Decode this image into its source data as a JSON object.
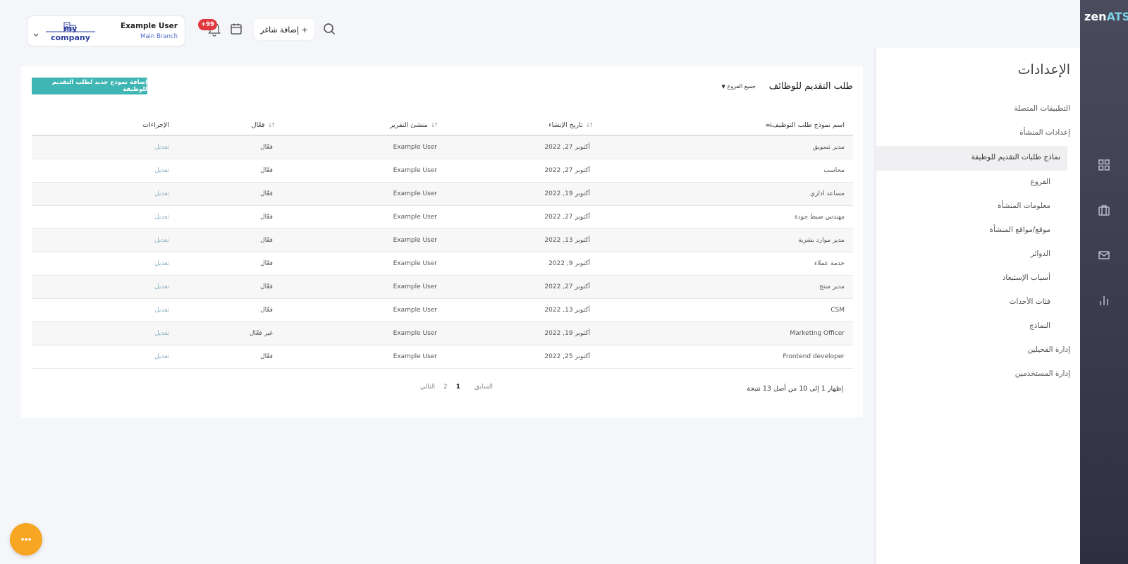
{
  "brand": {
    "logo_main": "zen",
    "logo_accent": "ATS"
  },
  "header": {
    "user_name": "Example User",
    "branch": "Main Branch",
    "company_name": "my company",
    "notification_badge": "+99",
    "add_job_label": "+ إضافة شاغر"
  },
  "settings": {
    "title": "الإعدادات",
    "items": [
      "التطبيقات المتصلة",
      "إعدادات المنشأة",
      "نماذج طلبات التقديم للوظيفة",
      "الفروع",
      "معلومات المنشأة",
      "موقع/مواقع المنشأة",
      "الدوائر",
      "أسباب الإستبعاد",
      "فئات الأحداث",
      "النماذج",
      "إدارة القحيلين",
      "إدارة المستخدمين"
    ],
    "active_index": 2
  },
  "main": {
    "title": "طلب التقديم للوظائف",
    "branch_filter": "جميع الفروع",
    "add_button": "إضافة نموذج جديد لطلب التقديم للوظيفة",
    "columns": {
      "name": "اسم نموذج طلب التوظيف",
      "date": "تاريخ الإنشاء",
      "creator": "منشئ التقرير",
      "active": "فعّال",
      "actions": "الإجراءات"
    },
    "rows": [
      {
        "name": "مدير تسويق",
        "date": "أكتوبر 27, 2022",
        "creator": "Example User",
        "active": "فعّال",
        "action": "تعديل"
      },
      {
        "name": "محاسب",
        "date": "أكتوبر 27, 2022",
        "creator": "Example User",
        "active": "فعّال",
        "action": "تعديل"
      },
      {
        "name": "مساعد اداري",
        "date": "أكتوبر 19, 2022",
        "creator": "Example User",
        "active": "فعّال",
        "action": "تعديل"
      },
      {
        "name": "مهندس ضبط جودة",
        "date": "أكتوبر 27, 2022",
        "creator": "Example User",
        "active": "فعّال",
        "action": "تعديل"
      },
      {
        "name": "مدير موارد بشرية",
        "date": "أكتوبر 13, 2022",
        "creator": "Example User",
        "active": "فعّال",
        "action": "تعديل"
      },
      {
        "name": "خدمة عملاء",
        "date": "أكتوبر 9, 2022",
        "creator": "Example User",
        "active": "فعّال",
        "action": "تعديل"
      },
      {
        "name": "مدير منتج",
        "date": "أكتوبر 27, 2022",
        "creator": "Example User",
        "active": "فعّال",
        "action": "تعديل"
      },
      {
        "name": "CSM",
        "date": "أكتوبر 13, 2022",
        "creator": "Example User",
        "active": "فعّال",
        "action": "تعديل"
      },
      {
        "name": "Marketing Officer",
        "date": "أكتوبر 19, 2022",
        "creator": "Example User",
        "active": "غير فعّال",
        "action": "تعديل"
      },
      {
        "name": "Frontend developer",
        "date": "أكتوبر 25, 2022",
        "creator": "Example User",
        "active": "فعّال",
        "action": "تعديل"
      }
    ],
    "showing_text": "إظهار 1 إلى 10 من أصل 13 نتيجة",
    "pager": {
      "prev": "السابق",
      "pages": [
        "1",
        "2"
      ],
      "current": "1",
      "next": "التالي"
    }
  },
  "icons": {
    "rail": [
      "grid-icon",
      "briefcase-icon",
      "mail-icon",
      "bar-chart-icon"
    ],
    "fab": "more-dots-icon"
  },
  "colors": {
    "rail_top": "#4a4c5e",
    "rail_bottom": "#2e3040",
    "accent_teal": "#3fb6b4",
    "badge_red": "#e0393e",
    "fab_orange": "#f6a623",
    "company_blue": "#2c3fa0"
  }
}
